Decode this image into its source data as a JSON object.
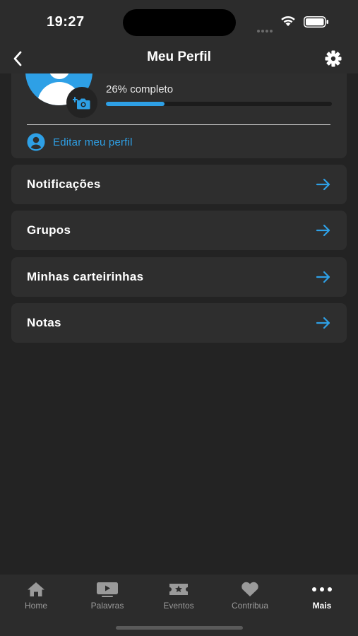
{
  "status_bar": {
    "time": "19:27"
  },
  "header": {
    "title": "Meu Perfil"
  },
  "profile": {
    "progress_text": "26% completo",
    "progress_fraction": 0.26,
    "edit_label": "Editar meu perfil"
  },
  "menu": {
    "items": [
      {
        "label": "Notificações"
      },
      {
        "label": "Grupos"
      },
      {
        "label": "Minhas carteirinhas"
      },
      {
        "label": "Notas"
      }
    ]
  },
  "tab_bar": {
    "tabs": [
      {
        "label": "Home",
        "icon": "home-icon"
      },
      {
        "label": "Palavras",
        "icon": "video-icon"
      },
      {
        "label": "Eventos",
        "icon": "ticket-icon"
      },
      {
        "label": "Contribua",
        "icon": "heart-icon"
      },
      {
        "label": "Mais",
        "icon": "more-icon"
      }
    ],
    "active_index": 4
  },
  "colors": {
    "accent": "#2ea0e6",
    "background": "#232323",
    "card": "#2e2e2e",
    "bar": "#2c2c2c"
  }
}
